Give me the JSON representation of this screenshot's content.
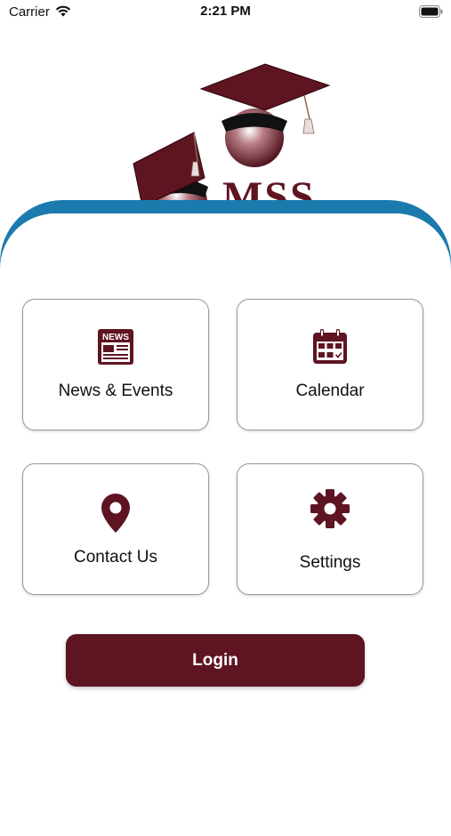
{
  "status_bar": {
    "carrier": "Carrier",
    "time": "2:21 PM"
  },
  "logo": {
    "text": "MSS"
  },
  "menu": {
    "tiles": [
      {
        "label": "News & Events",
        "icon": "newspaper-icon",
        "icon_text": "NEWS"
      },
      {
        "label": "Calendar",
        "icon": "calendar-icon"
      },
      {
        "label": "Contact Us",
        "icon": "location-pin-icon"
      },
      {
        "label": "Settings",
        "icon": "gear-icon"
      }
    ]
  },
  "login": {
    "label": "Login"
  },
  "colors": {
    "brand_maroon": "#5E1421",
    "accent_blue": "#1B7AAE",
    "tile_border": "#9A9A9A",
    "background": "#FFFFFF"
  }
}
